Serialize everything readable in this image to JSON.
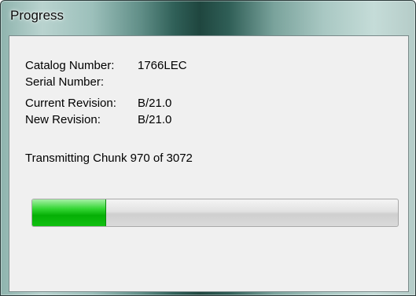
{
  "window": {
    "title": "Progress"
  },
  "details": {
    "catalog_number_label": "Catalog Number:",
    "catalog_number_value": "1766LEC",
    "serial_number_label": "Serial Number:",
    "serial_number_value": "",
    "current_revision_label": "Current Revision:",
    "current_revision_value": "B/21.0",
    "new_revision_label": "New Revision:",
    "new_revision_value": "B/21.0"
  },
  "status": {
    "text": "Transmitting Chunk 970 of 3072"
  },
  "progress": {
    "fraction": 0.2,
    "fill_color": "#06b006"
  }
}
